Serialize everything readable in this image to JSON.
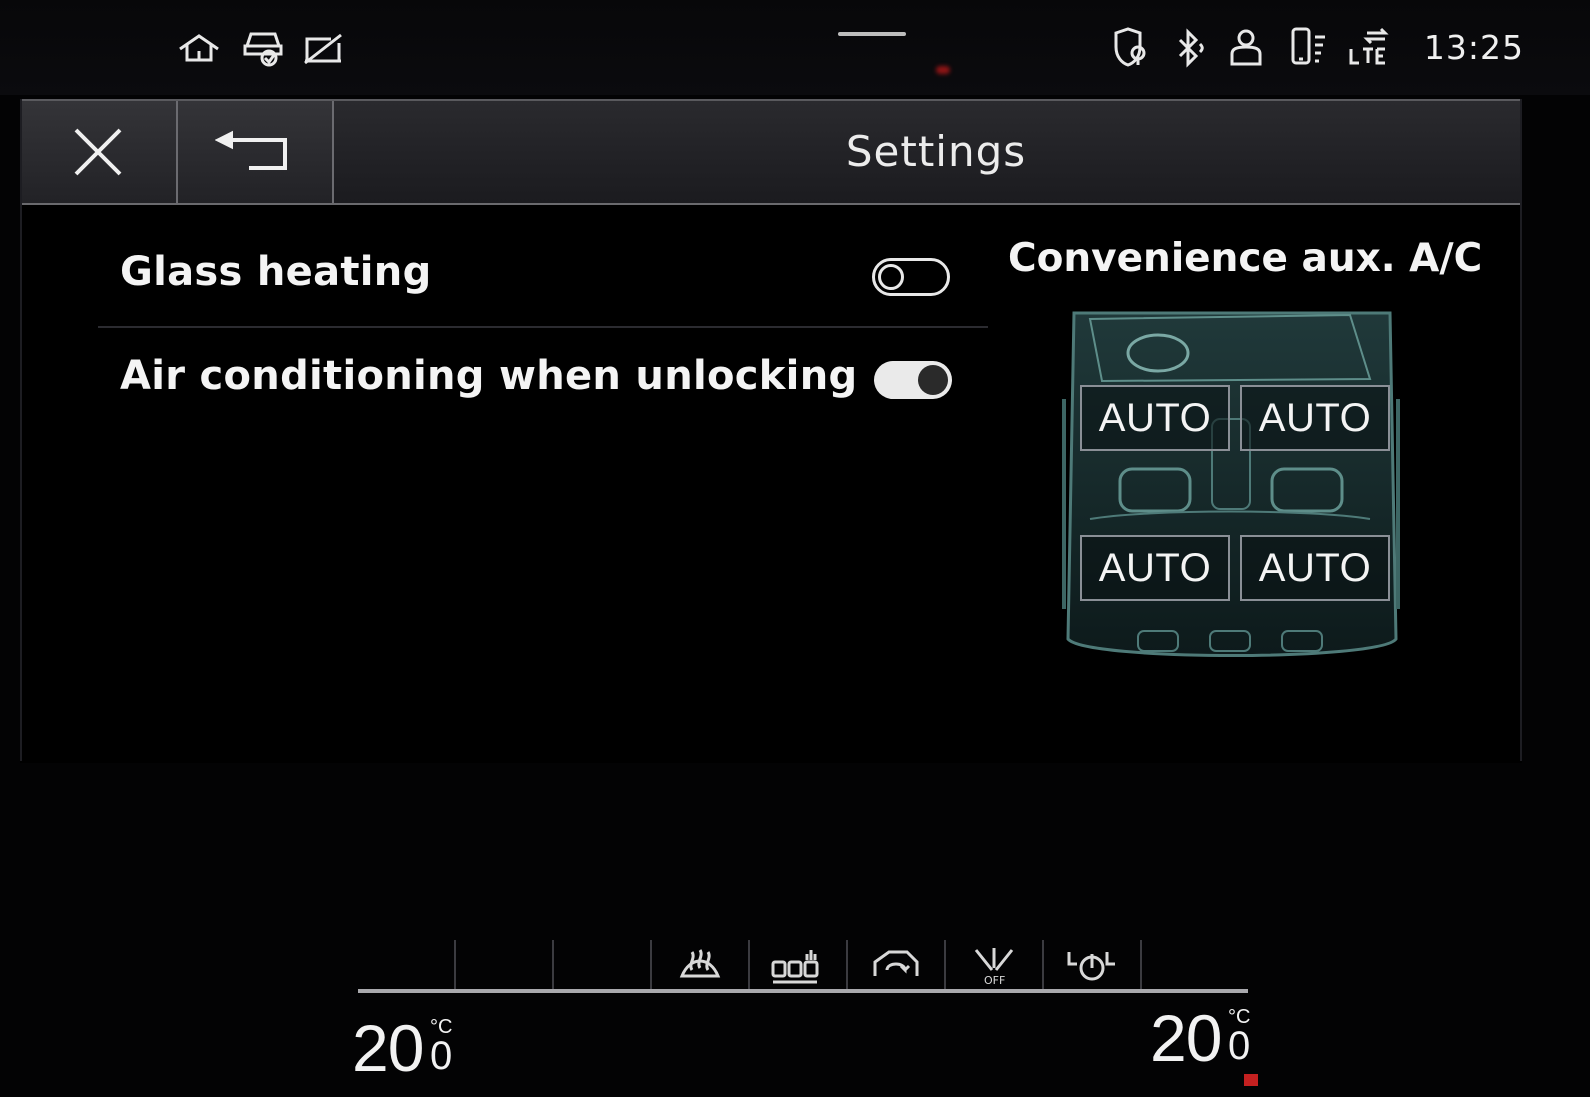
{
  "status_bar": {
    "time": "13:25",
    "left_icons": [
      "home-icon",
      "car-connect-icon",
      "no-signal-icon"
    ],
    "right_icons": [
      "location-shield-icon",
      "bluetooth-icon",
      "user-profile-icon",
      "phone-signal-icon",
      "lte-icon"
    ]
  },
  "header": {
    "title": "Settings",
    "close_icon": "close-icon",
    "back_icon": "back-icon"
  },
  "settings": [
    {
      "label": "Glass heating",
      "toggle": "off"
    },
    {
      "label": "Air conditioning when unlocking",
      "toggle": "on"
    }
  ],
  "convenience": {
    "title": "Convenience aux. A/C",
    "zones": {
      "front_left": "AUTO",
      "front_right": "AUTO",
      "rear_left": "AUTO",
      "rear_right": "AUTO"
    }
  },
  "climate_bar": {
    "buttons": [
      "empty",
      "empty",
      "empty",
      "defrost-icon",
      "seat-heating-icon",
      "recirculation-icon",
      "fan-off-icon",
      "climate-power-icon",
      "empty"
    ],
    "temp_left": {
      "value": "20",
      "decimal": "0",
      "unit": "°C"
    },
    "temp_right": {
      "value": "20",
      "decimal": "0",
      "unit": "°C"
    }
  },
  "colors": {
    "background": "#030304",
    "header": "#232327",
    "text": "#f2f2f2",
    "toggle_on": "#eaeaea",
    "zone_border": "#8a8f96"
  }
}
